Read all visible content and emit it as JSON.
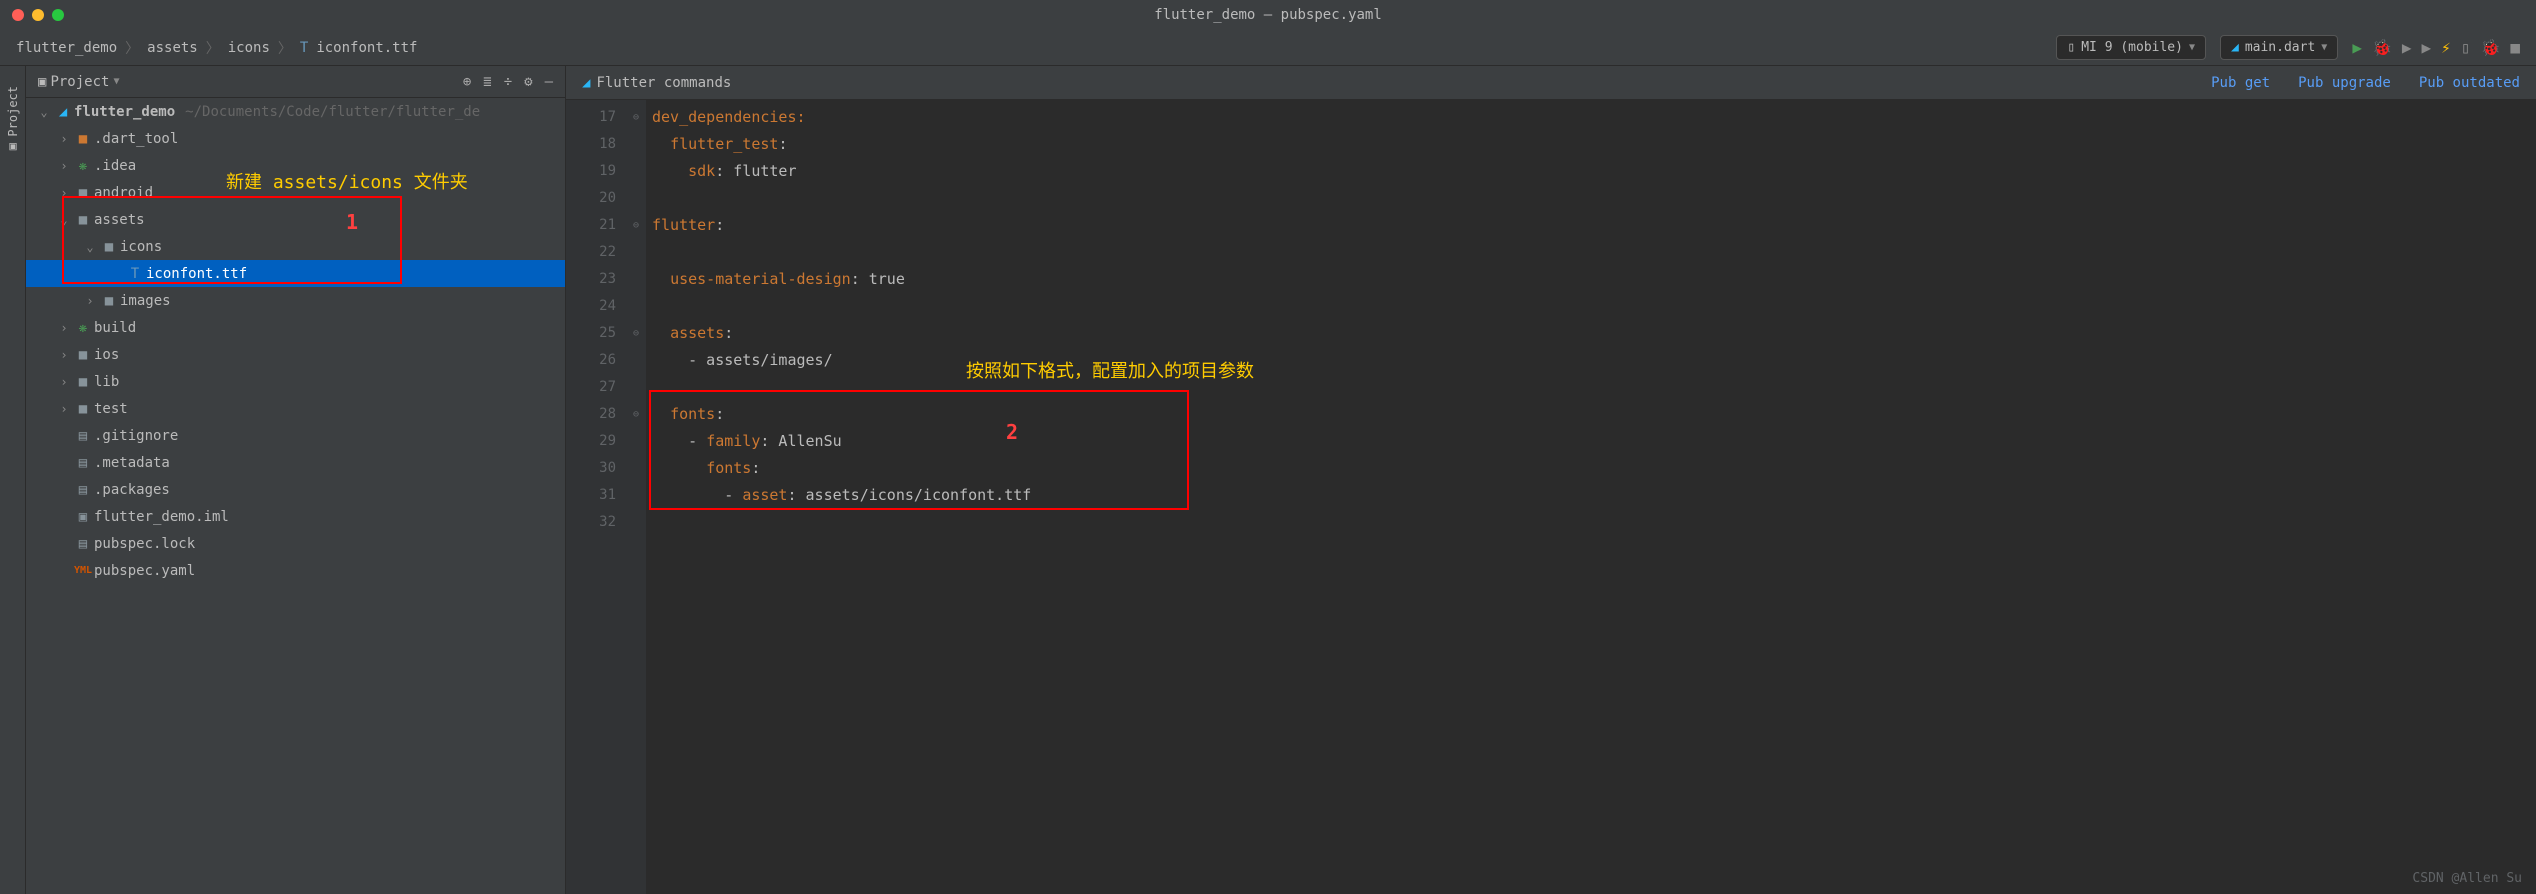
{
  "window": {
    "title": "flutter_demo – pubspec.yaml"
  },
  "breadcrumbs": {
    "project": "flutter_demo",
    "a": "assets",
    "b": "icons",
    "c": "iconfont.ttf"
  },
  "device": {
    "label": "MI 9 (mobile)"
  },
  "run_config": {
    "label": "main.dart"
  },
  "project_panel": {
    "title": "Project"
  },
  "side_tab": {
    "label": "Project"
  },
  "tree": {
    "root": "flutter_demo",
    "root_path": "~/Documents/Code/flutter/flutter_de",
    "items": [
      ".dart_tool",
      ".idea",
      "android",
      "assets",
      "icons",
      "iconfont.ttf",
      "images",
      "build",
      "ios",
      "lib",
      "test",
      ".gitignore",
      ".metadata",
      ".packages",
      "flutter_demo.iml",
      "pubspec.lock",
      "pubspec.yaml"
    ]
  },
  "annotations": {
    "label1": "新建 assets/icons 文件夹",
    "num1": "1",
    "label2": "按照如下格式，配置加入的项目参数",
    "num2": "2"
  },
  "editor_toolbar": {
    "commands": "Flutter commands"
  },
  "pub": {
    "get": "Pub get",
    "upgrade": "Pub upgrade",
    "outdated": "Pub outdated"
  },
  "gutter": [
    "17",
    "18",
    "19",
    "20",
    "21",
    "22",
    "23",
    "24",
    "25",
    "26",
    "27",
    "28",
    "29",
    "30",
    "31",
    "32"
  ],
  "code": {
    "l17": "dev_dependencies:",
    "l18_key": "flutter_test",
    "l18_colon": ":",
    "l19_key": "sdk",
    "l19_val": ": flutter",
    "l21_key": "flutter",
    "l21_colon": ":",
    "l23_key": "uses-material-design",
    "l23_val": ": true",
    "l25_key": "assets",
    "l25_colon": ":",
    "l26": "- assets/images/",
    "l28_key": "fonts",
    "l28_colon": ":",
    "l29_dash": "- ",
    "l29_key": "family",
    "l29_val": ": AllenSu",
    "l30_key": "fonts",
    "l30_colon": ":",
    "l31_dash": "- ",
    "l31_key": "asset",
    "l31_val": ": assets/icons/iconfont.ttf"
  },
  "watermark": "CSDN @Allen Su"
}
